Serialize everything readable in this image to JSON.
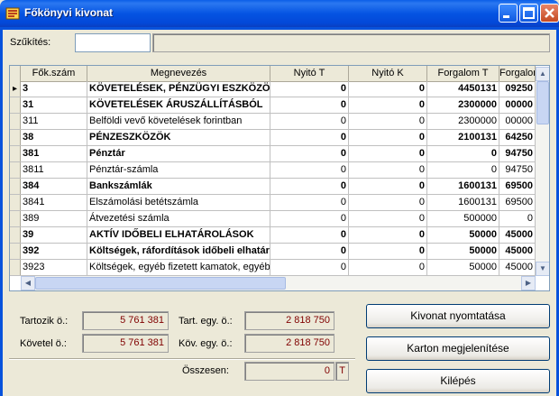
{
  "window": {
    "title": "Főkönyvi kivonat"
  },
  "filter": {
    "label": "Szűkítés:",
    "value": ""
  },
  "table": {
    "columns": [
      "Fők.szám",
      "Megnevezés",
      "Nyitó T",
      "Nyitó K",
      "Forgalom T",
      "Forgalom"
    ],
    "rows": [
      {
        "code": "3",
        "name": "KÖVETELÉSEK, PÉNZÜGYI ESZKÖZÖK",
        "nt": "0",
        "nk": "0",
        "ft": "4450131",
        "fk": "09250",
        "bold": true,
        "current": true
      },
      {
        "code": "31",
        "name": "KÖVETELÉSEK ÁRUSZÁLLÍTÁSBÓL",
        "nt": "0",
        "nk": "0",
        "ft": "2300000",
        "fk": "00000",
        "bold": true
      },
      {
        "code": "311",
        "name": "Belföldi vevő követelések forintban",
        "nt": "0",
        "nk": "0",
        "ft": "2300000",
        "fk": "00000",
        "bold": false
      },
      {
        "code": "38",
        "name": "PÉNZESZKÖZÖK",
        "nt": "0",
        "nk": "0",
        "ft": "2100131",
        "fk": "64250",
        "bold": true
      },
      {
        "code": "381",
        "name": "Pénztár",
        "nt": "0",
        "nk": "0",
        "ft": "0",
        "fk": "94750",
        "bold": true
      },
      {
        "code": "3811",
        "name": "Pénztár-számla",
        "nt": "0",
        "nk": "0",
        "ft": "0",
        "fk": "94750",
        "bold": false
      },
      {
        "code": "384",
        "name": "Bankszámlák",
        "nt": "0",
        "nk": "0",
        "ft": "1600131",
        "fk": "69500",
        "bold": true
      },
      {
        "code": "3841",
        "name": "Elszámolási betétszámla",
        "nt": "0",
        "nk": "0",
        "ft": "1600131",
        "fk": "69500",
        "bold": false
      },
      {
        "code": "389",
        "name": "Átvezetési számla",
        "nt": "0",
        "nk": "0",
        "ft": "500000",
        "fk": "0",
        "bold": false
      },
      {
        "code": "39",
        "name": "AKTÍV IDŐBELI ELHATÁROLÁSOK",
        "nt": "0",
        "nk": "0",
        "ft": "50000",
        "fk": "45000",
        "bold": true
      },
      {
        "code": "392",
        "name": "Költségek, ráfordítások időbeli elhatárolása",
        "nt": "0",
        "nk": "0",
        "ft": "50000",
        "fk": "45000",
        "bold": true
      },
      {
        "code": "3923",
        "name": "Költségek, egyéb fizetett kamatok, egyéb",
        "nt": "0",
        "nk": "0",
        "ft": "50000",
        "fk": "45000",
        "bold": false
      }
    ]
  },
  "totals": {
    "tartozik_label": "Tartozik ö.:",
    "tartozik_value": "5 761 381",
    "kovetel_label": "Követel ö.:",
    "kovetel_value": "5 761 381",
    "tart_egy_label": "Tart. egy. ö.:",
    "tart_egy_value": "2 818 750",
    "kov_egy_label": "Köv. egy. ö.:",
    "kov_egy_value": "2 818 750",
    "osszesen_label": "Összesen:",
    "osszesen_value": "0",
    "osszesen_side": "T"
  },
  "buttons": {
    "print": "Kivonat nyomtatása",
    "card": "Karton megjelenítése",
    "exit": "Kilépés"
  }
}
